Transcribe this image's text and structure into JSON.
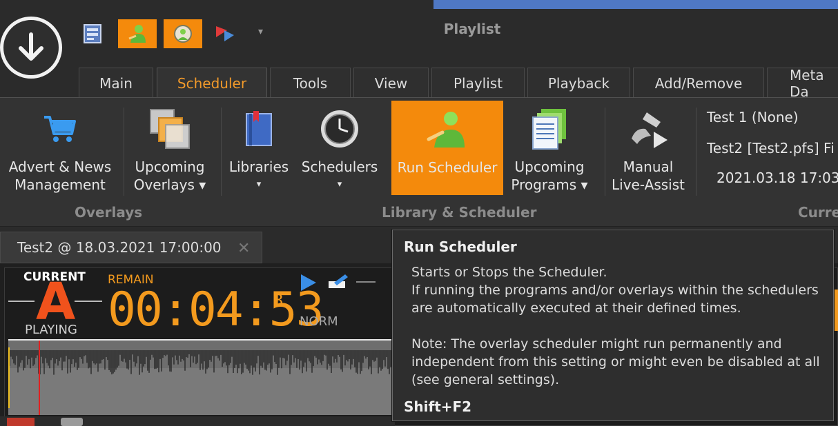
{
  "window": {
    "title": "Playlist"
  },
  "quick_access": [
    {
      "icon": "screen-icon",
      "active": false
    },
    {
      "icon": "run-scheduler-icon",
      "active": true
    },
    {
      "icon": "refresh-user-icon",
      "active": true
    },
    {
      "icon": "flag-play-icon",
      "active": false
    }
  ],
  "quick_access_more": "▾",
  "tabs": [
    "Main",
    "Scheduler",
    "Tools",
    "View",
    "Playlist",
    "Playback",
    "Add/Remove",
    "Meta Da"
  ],
  "active_tab": "Scheduler",
  "ribbon": {
    "advert": {
      "line1": "Advert & News",
      "line2": "Management"
    },
    "upcoming_overlays": {
      "line1": "Upcoming",
      "line2": "Overlays ▾"
    },
    "libraries": {
      "line1": "Libraries",
      "line2": "▾"
    },
    "schedulers": {
      "line1": "Schedulers",
      "line2": "▾"
    },
    "run_scheduler": {
      "line1": "Run Scheduler"
    },
    "upcoming_programs": {
      "line1": "Upcoming",
      "line2": "Programs ▾"
    },
    "manual_live_assist": {
      "line1": "Manual",
      "line2": "Live-Assist"
    },
    "groups": {
      "overlays": "Overlays",
      "library_scheduler": "Library & Scheduler",
      "current": "Curre"
    }
  },
  "current_info": {
    "line1": "Test 1 (None)",
    "line2": "Test2 [Test2.pfs] Fi",
    "line3": "2021.03.18 17:03:"
  },
  "document_tab": {
    "label": "Test2 @ 18.03.2021 17:00:00",
    "close": "✕"
  },
  "player": {
    "deck_label": "CURRENT",
    "deck_letter": "A",
    "state": "PLAYING",
    "remain_label": "REMAIN",
    "time": "00:04:53",
    "frames": "8",
    "mode": "NORM"
  },
  "tooltip": {
    "title": "Run Scheduler",
    "line1": "Starts or Stops the Scheduler.",
    "line2": "If running the programs and/or overlays within the schedulers",
    "line3": "are automatically executed at their defined times.",
    "line4": "Note: The overlay scheduler might run permanently and",
    "line5": "independent from this setting or might even be disabled at all",
    "line6": "(see general settings).",
    "shortcut": "Shift+F2"
  },
  "colors": {
    "accent": "#f48a0c",
    "deck": "#f0521c",
    "bar": "#4f78c4"
  }
}
